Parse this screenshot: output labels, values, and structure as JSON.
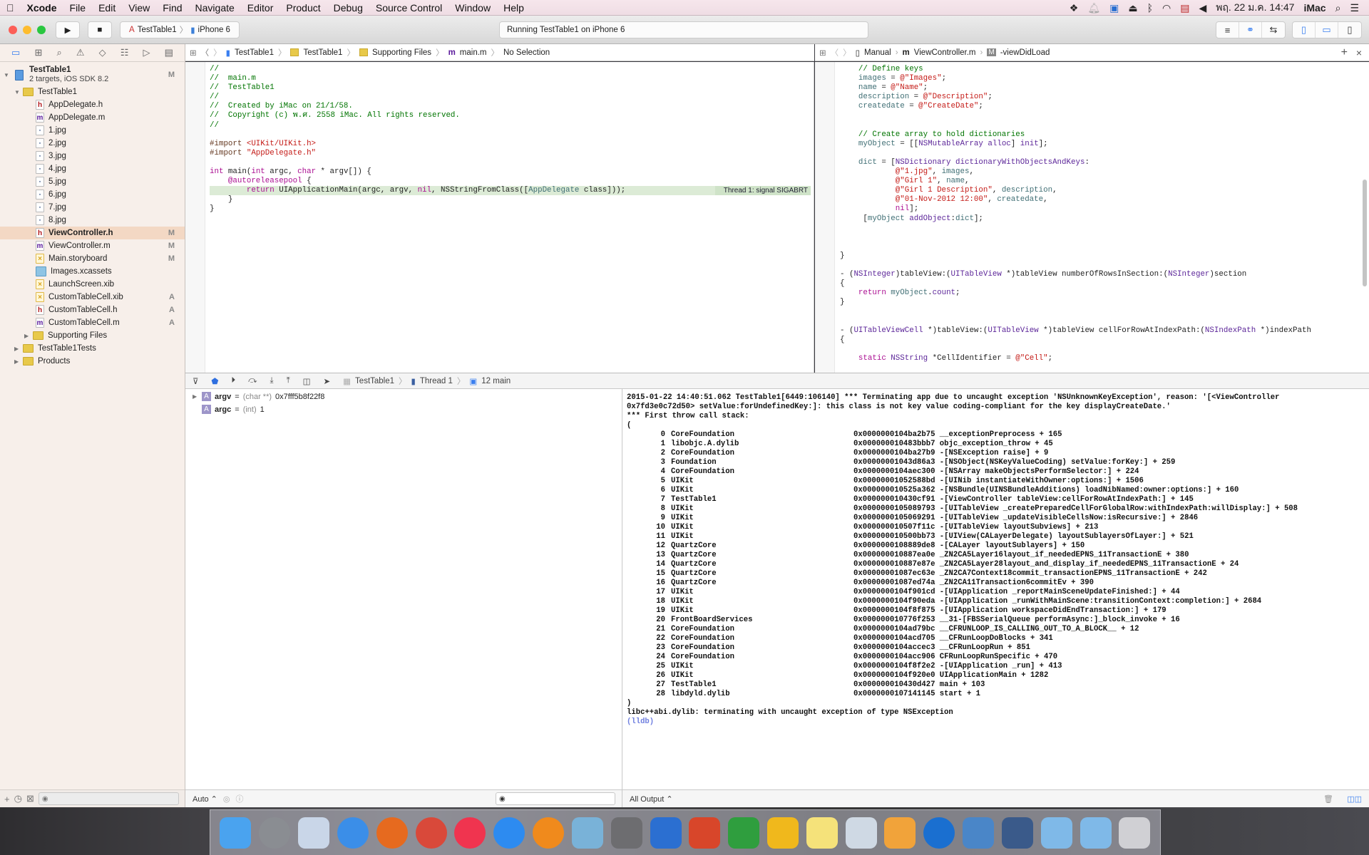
{
  "menubar": {
    "app": "Xcode",
    "items": [
      "File",
      "Edit",
      "View",
      "Find",
      "Navigate",
      "Editor",
      "Product",
      "Debug",
      "Source Control",
      "Window",
      "Help"
    ],
    "clock": "พฤ. 22 ม.ค.  14:47",
    "user": "iMac"
  },
  "toolbar": {
    "scheme": "TestTable1",
    "device": "iPhone 6",
    "status": "Running TestTable1 on iPhone 6"
  },
  "navigator": {
    "project": "TestTable1",
    "project_sub": "2 targets, iOS SDK 8.2",
    "project_badge": "M",
    "items": [
      {
        "label": "TestTable1",
        "icon": "folder",
        "depth": 1,
        "disc": "open"
      },
      {
        "label": "AppDelegate.h",
        "icon": "h",
        "depth": 2
      },
      {
        "label": "AppDelegate.m",
        "icon": "m",
        "depth": 2
      },
      {
        "label": "1.jpg",
        "icon": "jpg",
        "depth": 2
      },
      {
        "label": "2.jpg",
        "icon": "jpg",
        "depth": 2
      },
      {
        "label": "3.jpg",
        "icon": "jpg",
        "depth": 2
      },
      {
        "label": "4.jpg",
        "icon": "jpg",
        "depth": 2
      },
      {
        "label": "5.jpg",
        "icon": "jpg",
        "depth": 2
      },
      {
        "label": "6.jpg",
        "icon": "jpg",
        "depth": 2
      },
      {
        "label": "7.jpg",
        "icon": "jpg",
        "depth": 2
      },
      {
        "label": "8.jpg",
        "icon": "jpg",
        "depth": 2
      },
      {
        "label": "ViewController.h",
        "icon": "h",
        "depth": 2,
        "badge": "M",
        "selected": true
      },
      {
        "label": "ViewController.m",
        "icon": "m",
        "depth": 2,
        "badge": "M"
      },
      {
        "label": "Main.storyboard",
        "icon": "storyboard",
        "depth": 2,
        "badge": "M"
      },
      {
        "label": "Images.xcassets",
        "icon": "xcassets",
        "depth": 2
      },
      {
        "label": "LaunchScreen.xib",
        "icon": "xib",
        "depth": 2
      },
      {
        "label": "CustomTableCell.xib",
        "icon": "xib",
        "depth": 2,
        "badge": "A"
      },
      {
        "label": "CustomTableCell.h",
        "icon": "h",
        "depth": 2,
        "badge": "A"
      },
      {
        "label": "CustomTableCell.m",
        "icon": "m",
        "depth": 2,
        "badge": "A"
      },
      {
        "label": "Supporting Files",
        "icon": "folder",
        "depth": 2,
        "disc": "closed"
      },
      {
        "label": "TestTable1Tests",
        "icon": "folder",
        "depth": 1,
        "disc": "closed"
      },
      {
        "label": "Products",
        "icon": "folder",
        "depth": 1,
        "disc": "closed"
      }
    ]
  },
  "left_editor": {
    "jump": [
      "TestTable1",
      "TestTable1",
      "Supporting Files",
      "main.m",
      "No Selection"
    ],
    "annotation": "Thread 1: signal SIGABRT",
    "highlight_line": 13,
    "lines": [
      [
        [
          "c",
          "//"
        ]
      ],
      [
        [
          "c",
          "//  main.m"
        ]
      ],
      [
        [
          "c",
          "//  TestTable1"
        ]
      ],
      [
        [
          "c",
          "//"
        ]
      ],
      [
        [
          "c",
          "//  Created by iMac on 21/1/58."
        ]
      ],
      [
        [
          "c",
          "//  Copyright (c) พ.ศ. 2558 iMac. All rights reserved."
        ]
      ],
      [
        [
          "c",
          "//"
        ]
      ],
      [],
      [
        [
          "p",
          "#import "
        ],
        [
          "s",
          "<UIKit/UIKit.h>"
        ]
      ],
      [
        [
          "p",
          "#import "
        ],
        [
          "s",
          "\"AppDelegate.h\""
        ]
      ],
      [],
      [
        [
          "k",
          "int"
        ],
        [
          "",
          " main("
        ],
        [
          "k",
          "int"
        ],
        [
          "",
          " argc, "
        ],
        [
          "k",
          "char"
        ],
        [
          "",
          " * argv[]) {"
        ]
      ],
      [
        [
          "",
          "    "
        ],
        [
          "k",
          "@autoreleasepool"
        ],
        [
          "",
          " {"
        ]
      ],
      [
        [
          "",
          "        "
        ],
        [
          "k",
          "return"
        ],
        [
          "",
          " UIApplicationMain(argc, argv, "
        ],
        [
          "k",
          "nil"
        ],
        [
          "",
          ", NSStringFromClass(["
        ],
        [
          "v",
          "AppDelegate"
        ],
        [
          "",
          " class]));"
        ]
      ],
      [
        [
          "",
          "    }"
        ]
      ],
      [
        [
          "",
          "}"
        ]
      ]
    ]
  },
  "right_editor": {
    "jump": [
      "Manual",
      "ViewController.m",
      "-viewDidLoad"
    ],
    "lines": [
      [
        [
          "",
          "    "
        ],
        [
          "c",
          "// Define keys"
        ]
      ],
      [
        [
          "",
          "    "
        ],
        [
          "v",
          "images"
        ],
        [
          "",
          " = "
        ],
        [
          "s",
          "@\"Images\""
        ],
        [
          "",
          ";"
        ]
      ],
      [
        [
          "",
          "    "
        ],
        [
          "v",
          "name"
        ],
        [
          "",
          " = "
        ],
        [
          "s",
          "@\"Name\""
        ],
        [
          "",
          ";"
        ]
      ],
      [
        [
          "",
          "    "
        ],
        [
          "v",
          "description"
        ],
        [
          "",
          " = "
        ],
        [
          "s",
          "@\"Description\""
        ],
        [
          "",
          ";"
        ]
      ],
      [
        [
          "",
          "    "
        ],
        [
          "v",
          "createdate"
        ],
        [
          "",
          " = "
        ],
        [
          "s",
          "@\"CreateDate\""
        ],
        [
          "",
          ";"
        ]
      ],
      [],
      [],
      [
        [
          "",
          "    "
        ],
        [
          "c",
          "// Create array to hold dictionaries"
        ]
      ],
      [
        [
          "",
          "    "
        ],
        [
          "v",
          "myObject"
        ],
        [
          "",
          " = [["
        ],
        [
          "t",
          "NSMutableArray"
        ],
        [
          "",
          " "
        ],
        [
          "t",
          "alloc"
        ],
        [
          "",
          "] "
        ],
        [
          "t",
          "init"
        ],
        [
          "",
          "];"
        ]
      ],
      [],
      [
        [
          "",
          "    "
        ],
        [
          "v",
          "dict"
        ],
        [
          "",
          " = ["
        ],
        [
          "t",
          "NSDictionary"
        ],
        [
          "",
          " "
        ],
        [
          "t",
          "dictionaryWithObjectsAndKeys"
        ],
        [
          "",
          ":"
        ]
      ],
      [
        [
          "",
          "            "
        ],
        [
          "s",
          "@\"1.jpg\""
        ],
        [
          "",
          ", "
        ],
        [
          "v",
          "images"
        ],
        [
          "",
          ","
        ]
      ],
      [
        [
          "",
          "            "
        ],
        [
          "s",
          "@\"Girl 1\""
        ],
        [
          "",
          ", "
        ],
        [
          "v",
          "name"
        ],
        [
          "",
          ","
        ]
      ],
      [
        [
          "",
          "            "
        ],
        [
          "s",
          "@\"Girl 1 Description\""
        ],
        [
          "",
          ", "
        ],
        [
          "v",
          "description"
        ],
        [
          "",
          ","
        ]
      ],
      [
        [
          "",
          "            "
        ],
        [
          "s",
          "@\"01-Nov-2012 12:00\""
        ],
        [
          "",
          ", "
        ],
        [
          "v",
          "createdate"
        ],
        [
          "",
          ","
        ]
      ],
      [
        [
          "",
          "            "
        ],
        [
          "k",
          "nil"
        ],
        [
          "",
          "];"
        ]
      ],
      [
        [
          "",
          "     ["
        ],
        [
          "v",
          "myObject"
        ],
        [
          "",
          " "
        ],
        [
          "t",
          "addObject"
        ],
        [
          "",
          ":"
        ],
        [
          "v",
          "dict"
        ],
        [
          "",
          "];"
        ]
      ],
      [],
      [],
      [],
      [
        [
          "",
          "}"
        ]
      ],
      [],
      [
        [
          "",
          "- ("
        ],
        [
          "t",
          "NSInteger"
        ],
        [
          "",
          ")tableView:("
        ],
        [
          "t",
          "UITableView"
        ],
        [
          "",
          " *)tableView numberOfRowsInSection:("
        ],
        [
          "t",
          "NSInteger"
        ],
        [
          "",
          ")section"
        ]
      ],
      [
        [
          "",
          "{"
        ]
      ],
      [
        [
          "",
          "    "
        ],
        [
          "k",
          "return"
        ],
        [
          "",
          " "
        ],
        [
          "v",
          "myObject"
        ],
        [
          "",
          "."
        ],
        [
          "t",
          "count"
        ],
        [
          "",
          ";"
        ]
      ],
      [
        [
          "",
          "}"
        ]
      ],
      [],
      [],
      [
        [
          "",
          "- ("
        ],
        [
          "t",
          "UITableViewCell"
        ],
        [
          "",
          " *)tableView:("
        ],
        [
          "t",
          "UITableView"
        ],
        [
          "",
          " *)tableView cellForRowAtIndexPath:("
        ],
        [
          "t",
          "NSIndexPath"
        ],
        [
          "",
          " *)indexPath"
        ]
      ],
      [
        [
          "",
          "{"
        ]
      ],
      [],
      [
        [
          "",
          "    "
        ],
        [
          "k",
          "static"
        ],
        [
          "",
          " "
        ],
        [
          "t",
          "NSString"
        ],
        [
          "",
          " *CellIdentifier = "
        ],
        [
          "s",
          "@\"Cell\""
        ],
        [
          "",
          ";"
        ]
      ]
    ]
  },
  "debugbar": {
    "process": "TestTable1",
    "thread": "Thread 1",
    "frame": "12 main"
  },
  "variables": [
    {
      "name": "argv",
      "type": "(char **)",
      "value": "0x7fff5b8f22f8",
      "expandable": true
    },
    {
      "name": "argc",
      "type": "(int)",
      "value": "1"
    }
  ],
  "console": {
    "header": [
      "2015-01-22 14:40:51.062 TestTable1[6449:106140] *** Terminating app due to uncaught exception 'NSUnknownKeyException', reason: '[<ViewController",
      "0x7fd3e0c72d50> setValue:forUndefinedKey:]: this class is not key value coding-compliant for the key displayCreateDate.'",
      "*** First throw call stack:",
      "("
    ],
    "frames": [
      [
        "0",
        "CoreFoundation",
        "0x0000000104ba2b75",
        "__exceptionPreprocess + 165"
      ],
      [
        "1",
        "libobjc.A.dylib",
        "0x000000010483bbb7",
        "objc_exception_throw + 45"
      ],
      [
        "2",
        "CoreFoundation",
        "0x0000000104ba27b9",
        "-[NSException raise] + 9"
      ],
      [
        "3",
        "Foundation",
        "0x00000001043d86a3",
        "-[NSObject(NSKeyValueCoding) setValue:forKey:] + 259"
      ],
      [
        "4",
        "CoreFoundation",
        "0x0000000104aec300",
        "-[NSArray makeObjectsPerformSelector:] + 224"
      ],
      [
        "5",
        "UIKit",
        "0x00000001052588bd",
        "-[UINib instantiateWithOwner:options:] + 1506"
      ],
      [
        "6",
        "UIKit",
        "0x000000010525a362",
        "-[NSBundle(UINSBundleAdditions) loadNibNamed:owner:options:] + 160"
      ],
      [
        "7",
        "TestTable1",
        "0x000000010430cf91",
        "-[ViewController tableView:cellForRowAtIndexPath:] + 145"
      ],
      [
        "8",
        "UIKit",
        "0x0000000105089793",
        "-[UITableView _createPreparedCellForGlobalRow:withIndexPath:willDisplay:] + 508"
      ],
      [
        "9",
        "UIKit",
        "0x0000000105069291",
        "-[UITableView _updateVisibleCellsNow:isRecursive:] + 2846"
      ],
      [
        "10",
        "UIKit",
        "0x000000010507f11c",
        "-[UITableView layoutSubviews] + 213"
      ],
      [
        "11",
        "UIKit",
        "0x000000010500bb73",
        "-[UIView(CALayerDelegate) layoutSublayersOfLayer:] + 521"
      ],
      [
        "12",
        "QuartzCore",
        "0x0000000108889de8",
        "-[CALayer layoutSublayers] + 150"
      ],
      [
        "13",
        "QuartzCore",
        "0x000000010887ea0e",
        "_ZN2CA5Layer16layout_if_neededEPNS_11TransactionE + 380"
      ],
      [
        "14",
        "QuartzCore",
        "0x000000010887e87e",
        "_ZN2CA5Layer28layout_and_display_if_neededEPNS_11TransactionE + 24"
      ],
      [
        "15",
        "QuartzCore",
        "0x00000001087ec63e",
        "_ZN2CA7Context18commit_transactionEPNS_11TransactionE + 242"
      ],
      [
        "16",
        "QuartzCore",
        "0x00000001087ed74a",
        "_ZN2CA11Transaction6commitEv + 390"
      ],
      [
        "17",
        "UIKit",
        "0x0000000104f901cd",
        "-[UIApplication _reportMainSceneUpdateFinished:] + 44"
      ],
      [
        "18",
        "UIKit",
        "0x0000000104f90eda",
        "-[UIApplication _runWithMainScene:transitionContext:completion:] + 2684"
      ],
      [
        "19",
        "UIKit",
        "0x0000000104f8f875",
        "-[UIApplication workspaceDidEndTransaction:] + 179"
      ],
      [
        "20",
        "FrontBoardServices",
        "0x000000010776f253",
        "__31-[FBSSerialQueue performAsync:]_block_invoke + 16"
      ],
      [
        "21",
        "CoreFoundation",
        "0x0000000104ad79bc",
        "__CFRUNLOOP_IS_CALLING_OUT_TO_A_BLOCK__ + 12"
      ],
      [
        "22",
        "CoreFoundation",
        "0x0000000104acd705",
        "__CFRunLoopDoBlocks + 341"
      ],
      [
        "23",
        "CoreFoundation",
        "0x0000000104accec3",
        "__CFRunLoopRun + 851"
      ],
      [
        "24",
        "CoreFoundation",
        "0x0000000104acc906",
        "CFRunLoopRunSpecific + 470"
      ],
      [
        "25",
        "UIKit",
        "0x0000000104f8f2e2",
        "-[UIApplication _run] + 413"
      ],
      [
        "26",
        "UIKit",
        "0x0000000104f920e0",
        "UIApplicationMain + 1282"
      ],
      [
        "27",
        "TestTable1",
        "0x000000010430d427",
        "main + 103"
      ],
      [
        "28",
        "libdyld.dylib",
        "0x0000000107141145",
        "start + 1"
      ]
    ],
    "footer": [
      ")",
      "libc++abi.dylib: terminating with uncaught exception of type NSException"
    ],
    "prompt": "(lldb)"
  },
  "bottom": {
    "auto_label": "Auto ⌃",
    "output_label": "All Output ⌃"
  },
  "dock": [
    {
      "name": "finder",
      "color": "#4aa3ef"
    },
    {
      "name": "launchpad",
      "color": "#8a8d92"
    },
    {
      "name": "mail",
      "color": "#c9d6e8"
    },
    {
      "name": "safari",
      "color": "#3b8ee8"
    },
    {
      "name": "firefox",
      "color": "#e66a1f"
    },
    {
      "name": "chrome",
      "color": "#d9493a"
    },
    {
      "name": "itunes",
      "color": "#f0344f"
    },
    {
      "name": "app-store",
      "color": "#2d8bf0"
    },
    {
      "name": "ibooks",
      "color": "#f08a1c"
    },
    {
      "name": "iphoto",
      "color": "#79b2d8"
    },
    {
      "name": "system-preferences",
      "color": "#6d6d70"
    },
    {
      "name": "word",
      "color": "#2b6fd1"
    },
    {
      "name": "powerpoint",
      "color": "#d8462a"
    },
    {
      "name": "excel",
      "color": "#2f9e3e"
    },
    {
      "name": "outlook",
      "color": "#f0b81c"
    },
    {
      "name": "notes",
      "color": "#f5e27a"
    },
    {
      "name": "preview",
      "color": "#cfd9e4"
    },
    {
      "name": "pages",
      "color": "#f1a33a"
    },
    {
      "name": "teamviewer",
      "color": "#1a6fd0"
    },
    {
      "name": "xcode",
      "color": "#4a86c8"
    },
    {
      "name": "ios-simulator",
      "color": "#3a5a8a"
    },
    {
      "name": "folder-apps",
      "color": "#7fb9e8"
    },
    {
      "name": "folder-documents",
      "color": "#7fb9e8"
    },
    {
      "name": "trash",
      "color": "#d0d0d4"
    }
  ]
}
